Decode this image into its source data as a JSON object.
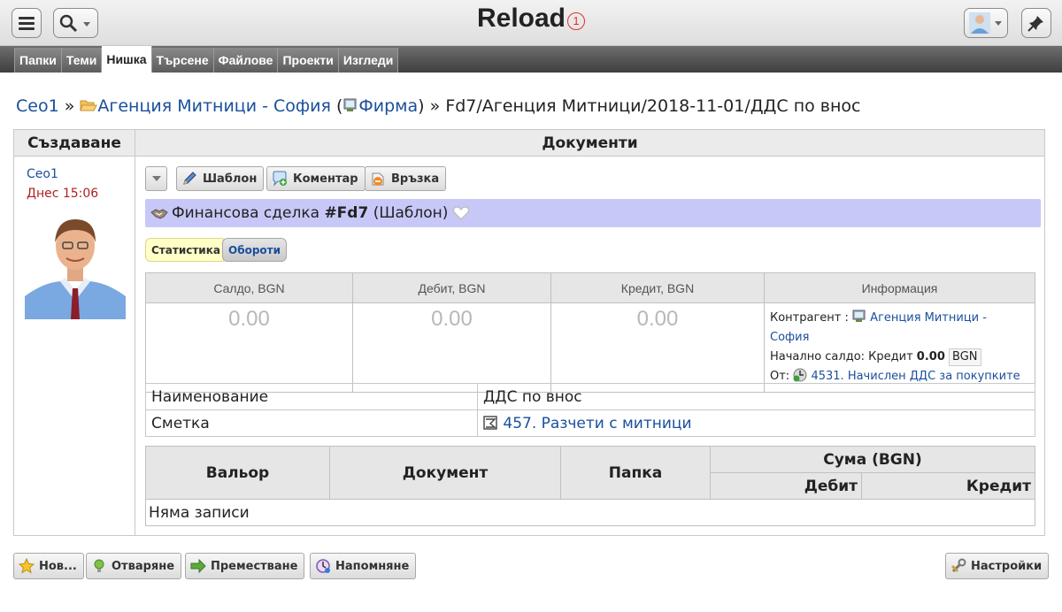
{
  "app": {
    "title": "Reload",
    "notification_count": "1"
  },
  "tabs": [
    {
      "label": "Папки"
    },
    {
      "label": "Теми"
    },
    {
      "label": "Нишка"
    },
    {
      "label": "Търсене"
    },
    {
      "label": "Файлове"
    },
    {
      "label": "Проекти"
    },
    {
      "label": "Изгледи"
    }
  ],
  "breadcrumb": {
    "user": "Ceo1",
    "sep": "»",
    "folder": "Агенция Митници - София",
    "open_paren": "(",
    "company": "Фирма",
    "close_paren": ")",
    "sep2": "»",
    "thread": "Fd7/Агенция Митници/2018-11-01/ДДС по внос"
  },
  "columns": {
    "creation": "Създаване",
    "documents": "Документи"
  },
  "author": {
    "name": "Ceo1",
    "time": "Днес 15:06"
  },
  "doc_toolbar": {
    "template": "Шаблон",
    "comment": "Коментар",
    "link": "Връзка"
  },
  "document": {
    "type": "Финансова сделка",
    "number": "#Fd7",
    "state": "(Шаблон)"
  },
  "subtabs": {
    "statistics": "Статистика",
    "turnovers": "Обороти"
  },
  "balances": {
    "headers": [
      "Салдо, BGN",
      "Дебит, BGN",
      "Кредит, BGN",
      "Информация"
    ],
    "saldo": "0.00",
    "debit": "0.00",
    "credit": "0.00",
    "info": {
      "contractor_label": "Контрагент :",
      "contractor": "Агенция Митници - София",
      "opening_label": "Начално салдо: Кредит",
      "opening_value": "0.00",
      "currency": "BGN",
      "from_label": "От:",
      "from_account": "4531. Начислен ДДС за покупките"
    }
  },
  "properties": [
    {
      "label": "Наименование",
      "value": "ДДС по внос"
    },
    {
      "label": "Сметка",
      "value": "457. Разчети с митници"
    }
  ],
  "entries": {
    "headers": {
      "valeur": "Вальор",
      "document": "Документ",
      "folder": "Папка",
      "amount": "Сума (BGN)",
      "debit": "Дебит",
      "credit": "Кредит"
    },
    "empty": "Няма записи"
  },
  "bottom_toolbar": {
    "new": "Нов...",
    "open": "Отваряне",
    "move": "Преместване",
    "remind": "Напомняне",
    "settings": "Настройки"
  },
  "colors": {
    "accent": "#1a4f9c",
    "highlight": "#c8c8f8",
    "tab_bar": "#4a4a4a",
    "time": "#b02020"
  }
}
